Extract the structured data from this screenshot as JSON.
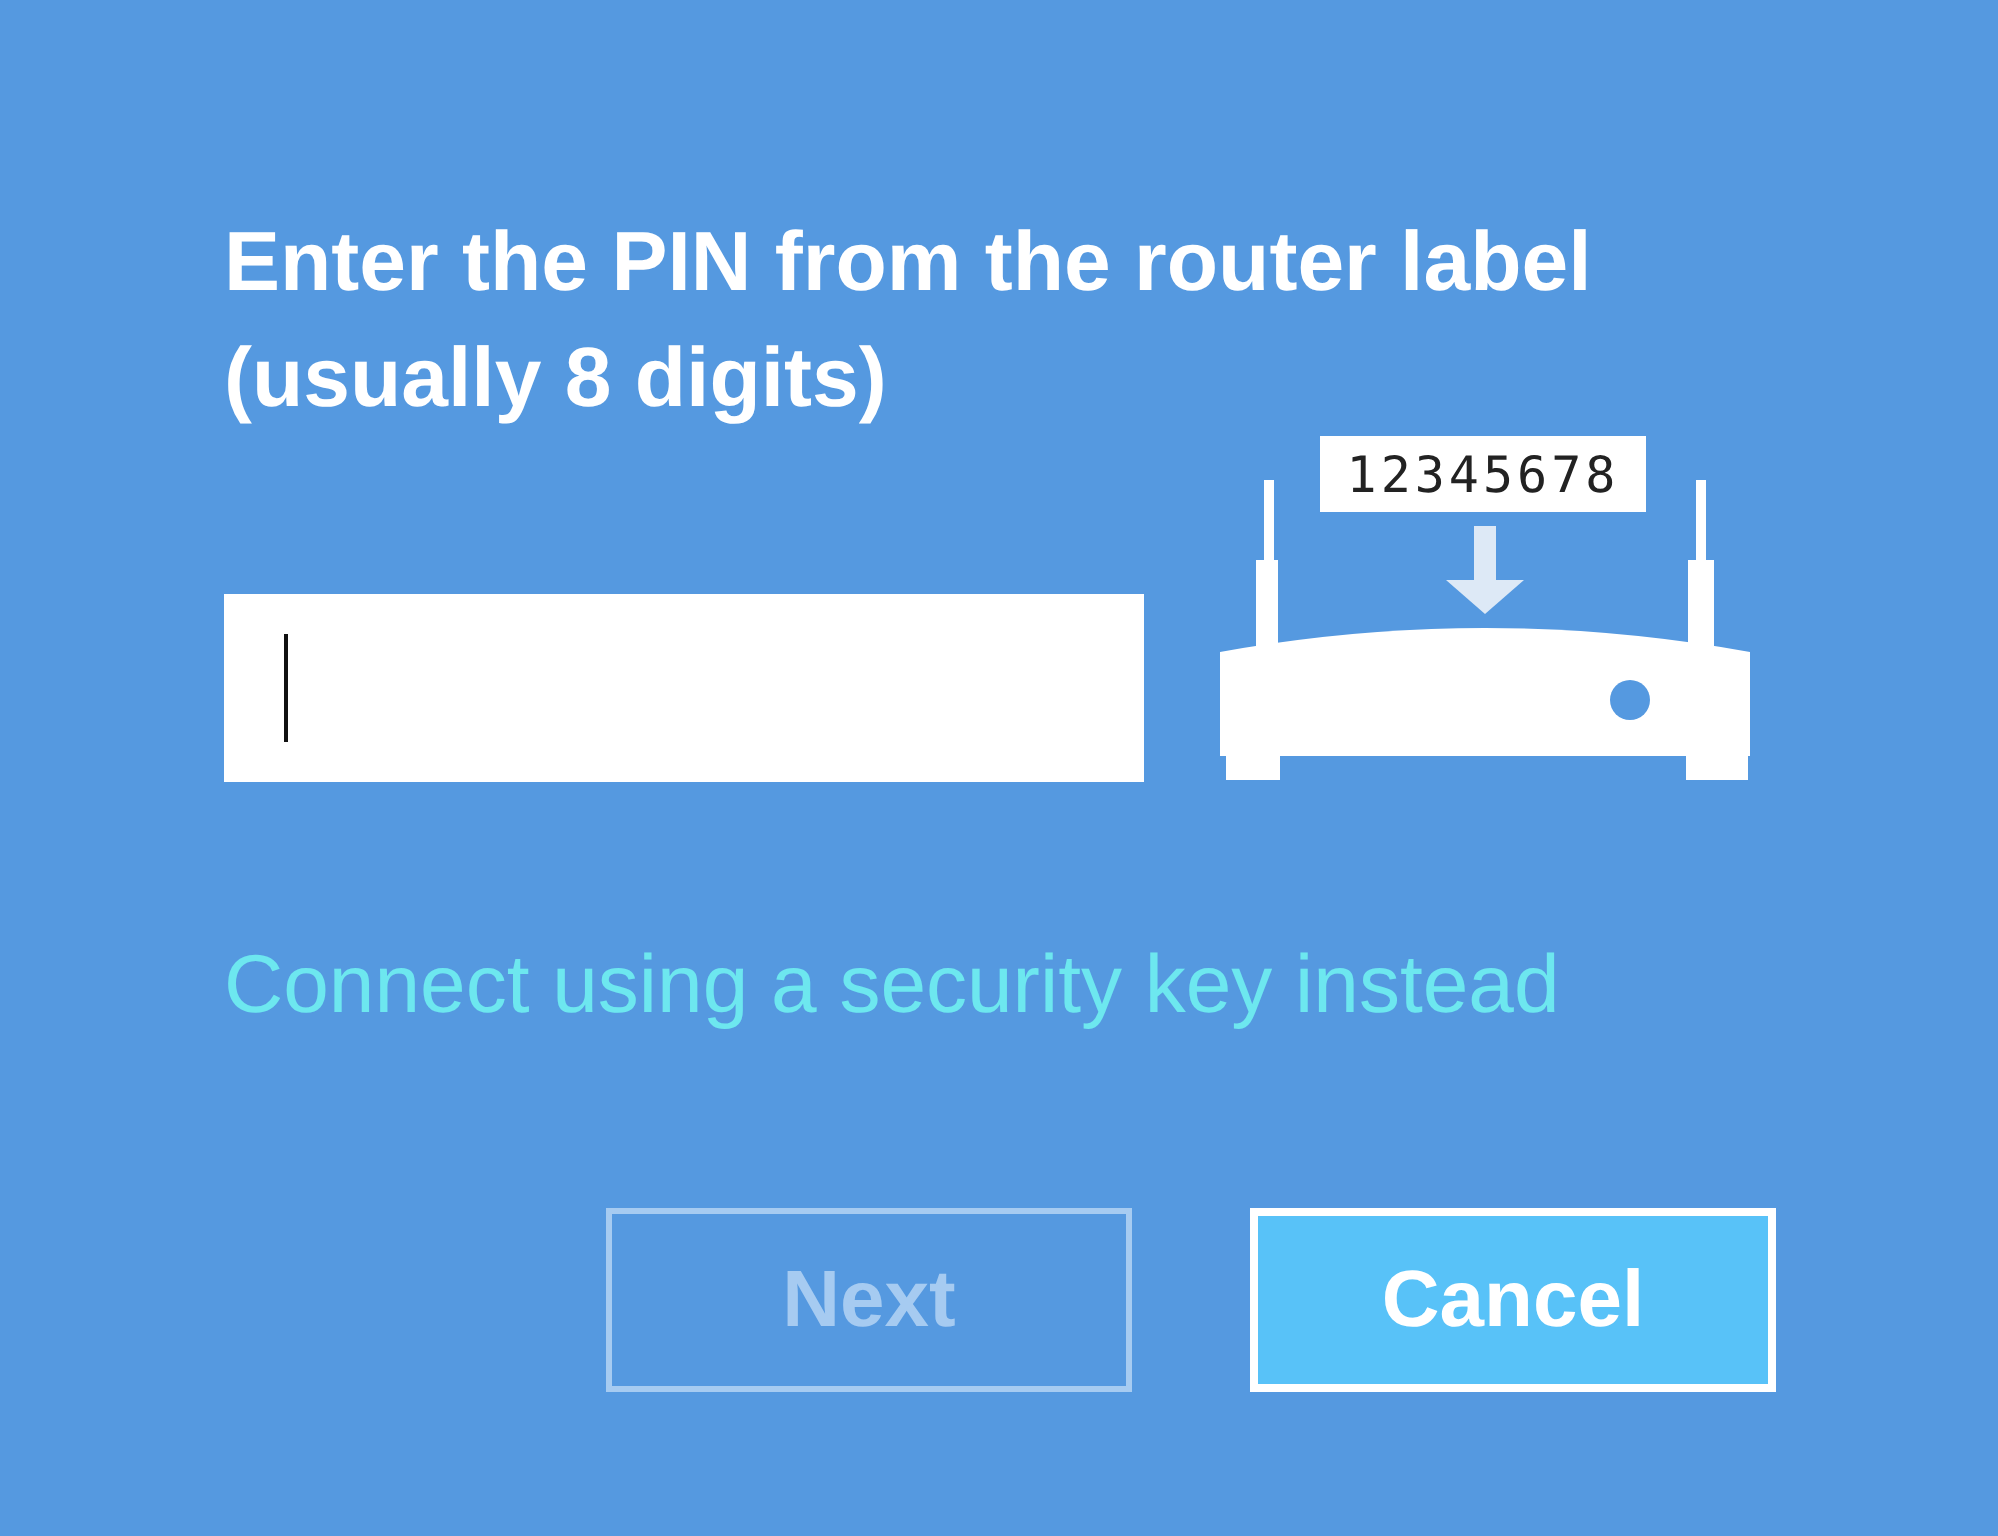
{
  "heading": "Enter the PIN from the router label (usually 8 digits)",
  "pin_field": {
    "focused": true
  },
  "router_label": "12345678",
  "link": "Connect using a security key instead",
  "buttons": [
    {
      "label": "Next",
      "disabled": true,
      "primary": false
    },
    {
      "label": "Cancel",
      "disabled": false,
      "primary": true
    }
  ]
}
